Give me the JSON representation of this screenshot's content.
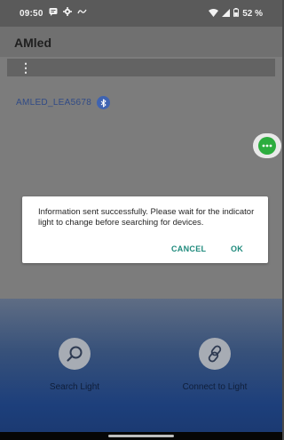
{
  "status_bar": {
    "time": "09:50",
    "left_icons": [
      "message-icon",
      "settings-icon",
      "nfc-icon"
    ],
    "right_icons": [
      "wifi-icon",
      "signal-icon",
      "battery-icon"
    ],
    "battery": "52 %"
  },
  "app": {
    "title": "AMled"
  },
  "toolbar": {
    "menu_icon": "more-vert-icon",
    "menu_glyph": "⋮"
  },
  "device": {
    "name": "AMLED_LEA5678",
    "icon": "bluetooth-icon"
  },
  "fab": {
    "icon": "more-horiz-icon",
    "color": "#2cad3e"
  },
  "dialog": {
    "message": "Information sent successfully. Please wait for the indicator light to change before searching for devices.",
    "cancel_label": "CANCEL",
    "ok_label": "OK",
    "button_color": "#1e8a7c"
  },
  "actions": [
    {
      "label": "Search Light",
      "icon": "search-icon"
    },
    {
      "label": "Connect to Light",
      "icon": "link-icon"
    }
  ]
}
